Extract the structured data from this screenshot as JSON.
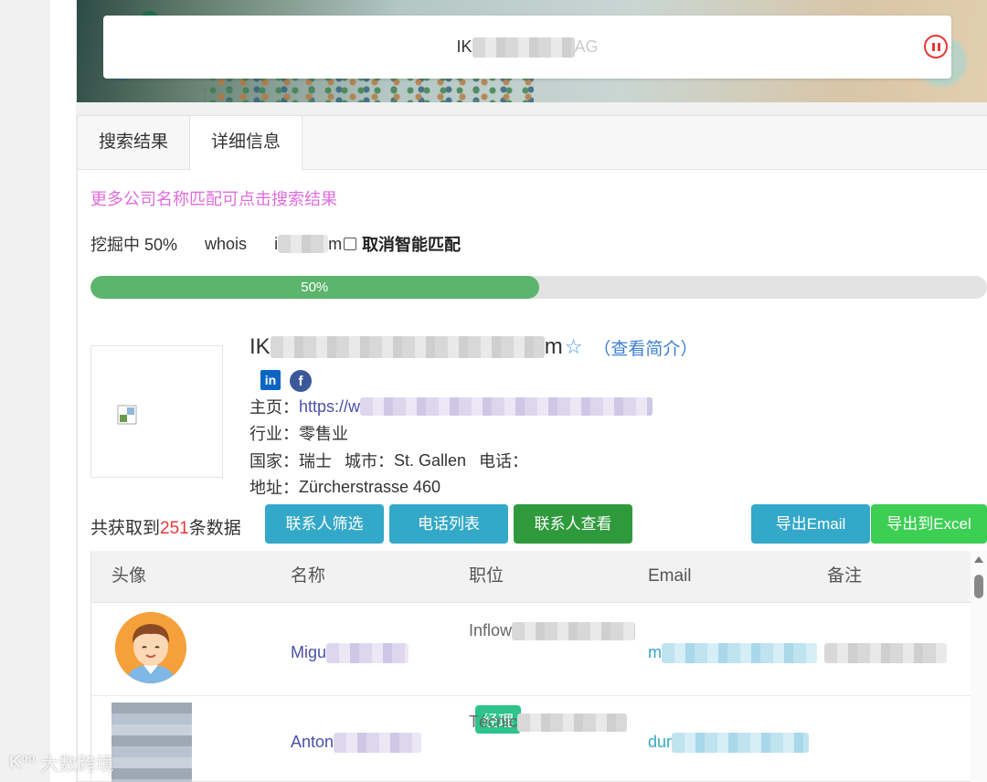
{
  "search": {
    "query": "IK",
    "query_tail": "AG"
  },
  "tabs": [
    {
      "label": "搜索结果"
    },
    {
      "label": "详细信息"
    }
  ],
  "hint": "更多公司名称匹配可点击搜索结果",
  "status": {
    "mining": "挖掘中 50%",
    "whois": "whois",
    "domain_prefix": "i",
    "domain_suffix": "m",
    "cancel_label": "取消智能匹配"
  },
  "progress": {
    "value": 50,
    "label": "50%"
  },
  "company": {
    "name_prefix": "IK",
    "name_suffix": "m",
    "view_profile": "（查看简介）",
    "linkedin_text": "in",
    "facebook_text": "f",
    "homepage_label": "主页：",
    "homepage_value": "https://w",
    "industry_label": "行业：",
    "industry_value": "零售业",
    "country_label": "国家：",
    "country_value": "瑞士",
    "city_label": "城市：",
    "city_value": "St. Gallen",
    "phone_label": "电话：",
    "address_label": "地址：",
    "address_value": "Zürcherstrasse 460"
  },
  "results": {
    "prefix": "共获取到",
    "count": "251",
    "suffix": "条数据"
  },
  "buttons": {
    "filter": "联系人筛选",
    "phones": "电话列表",
    "view_contacts": "联系人查看",
    "export_email": "导出Email",
    "export_excel": "导出到Excel"
  },
  "table": {
    "headers": [
      "头像",
      "名称",
      "职位",
      "Email",
      "备注"
    ],
    "rows": [
      {
        "name": "Migu",
        "position": "Inflow",
        "badge": "经理",
        "email": "m"
      },
      {
        "name": "Anton",
        "position": "Técnic",
        "email": "dur"
      }
    ]
  },
  "watermark": {
    "logo": "K⁰⁰",
    "text": "大数跨境"
  },
  "colors": {
    "accent_teal": "#34a8c8",
    "accent_green": "#2f9a3c",
    "excel_green": "#3ccf53",
    "progress": "#5cb56d",
    "hint": "#e06cde",
    "count_red": "#e53935"
  }
}
